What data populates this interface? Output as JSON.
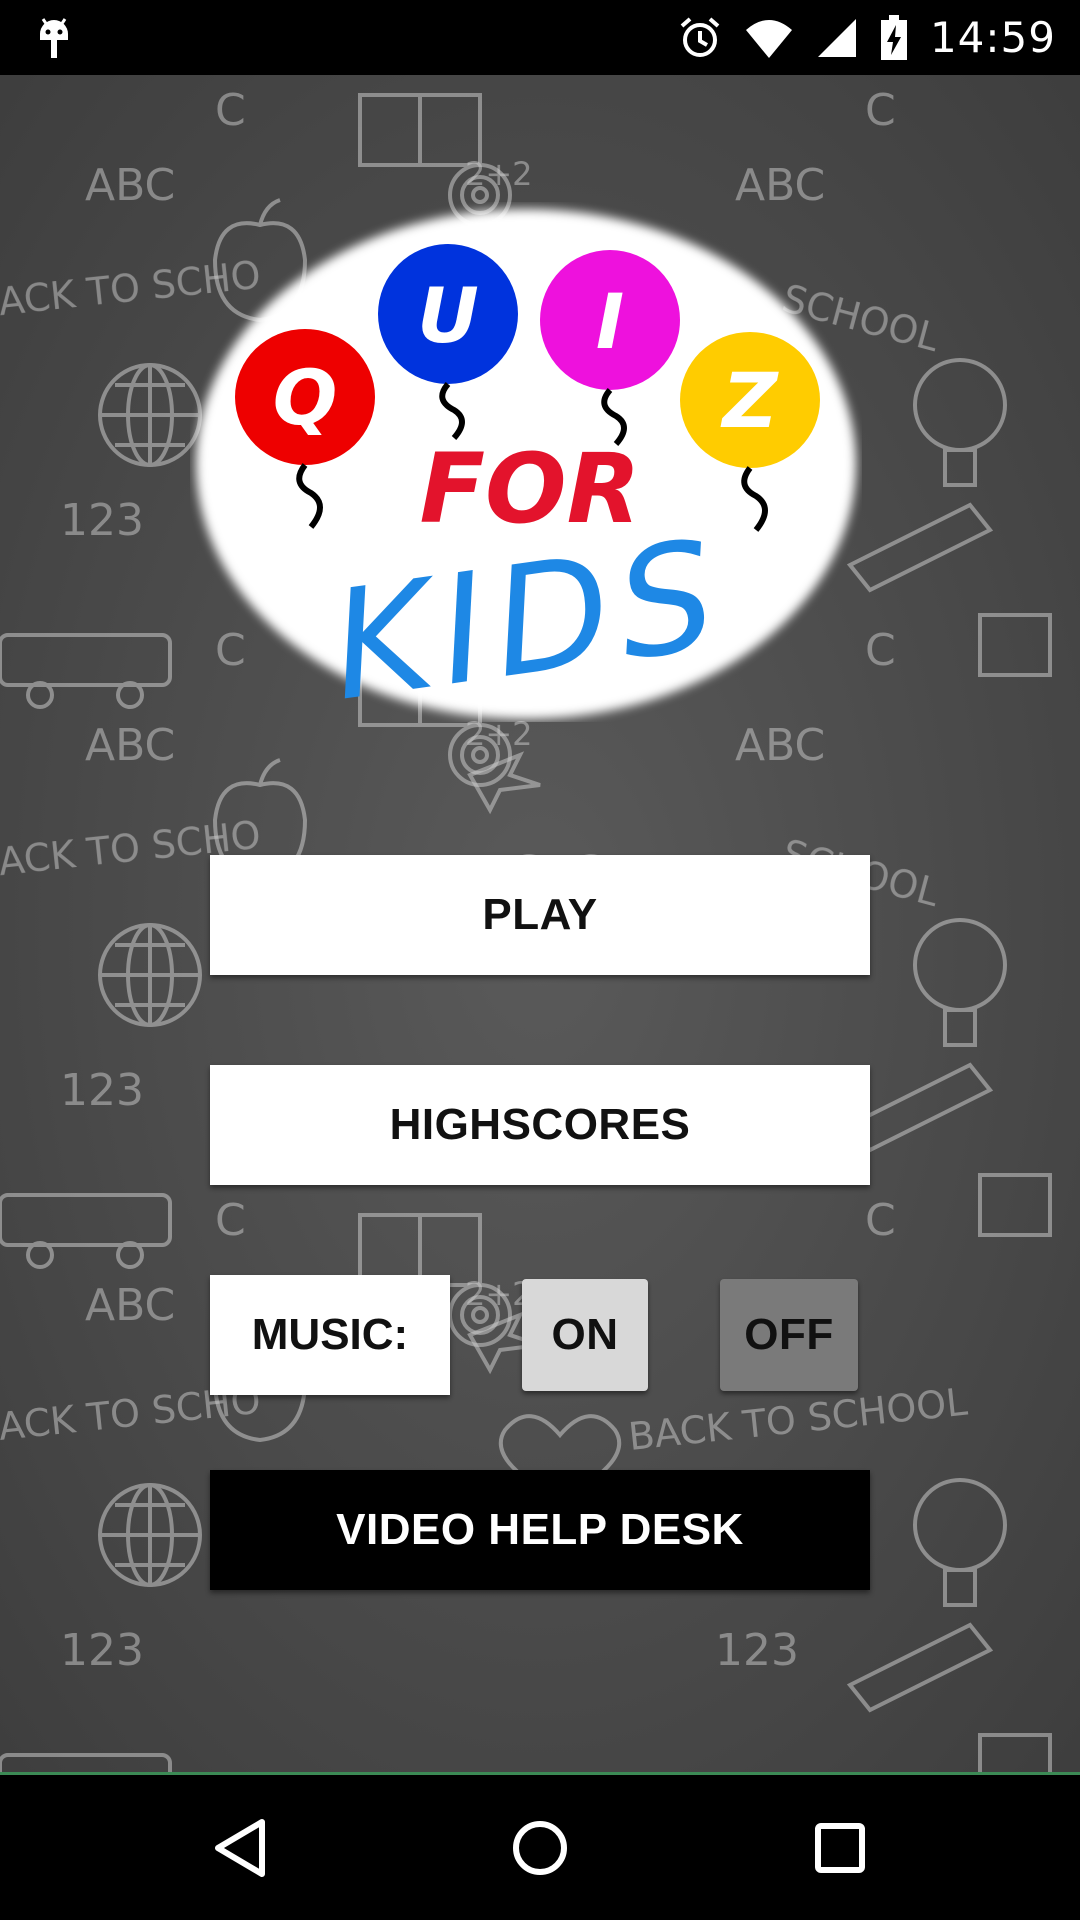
{
  "status_bar": {
    "time": "14:59",
    "icons": [
      "android-debug-icon",
      "alarm-icon",
      "wifi-icon",
      "cell-signal-icon",
      "battery-charging-icon"
    ]
  },
  "logo": {
    "letters": [
      "Q",
      "U",
      "I",
      "Z"
    ],
    "line2": "FOR",
    "line3": "KIDS",
    "colors": {
      "q_balloon": "#ee0000",
      "u_balloon": "#0033dd",
      "i_balloon": "#ee11dd",
      "z_balloon": "#ffcc00",
      "for_text": "#e3132c",
      "kids_text": "#1e88e5"
    }
  },
  "menu": {
    "play_label": "PLAY",
    "highscores_label": "HIGHSCORES",
    "music_label": "MUSIC:",
    "music_on_label": "ON",
    "music_off_label": "OFF",
    "video_help_label": "VIDEO HELP DESK"
  },
  "colors": {
    "chalkboard": "#4d4d4d",
    "button_bg": "#ffffff",
    "on_bg": "#d8d8d8",
    "off_bg": "#7a7a7a",
    "video_bg": "#000000"
  }
}
